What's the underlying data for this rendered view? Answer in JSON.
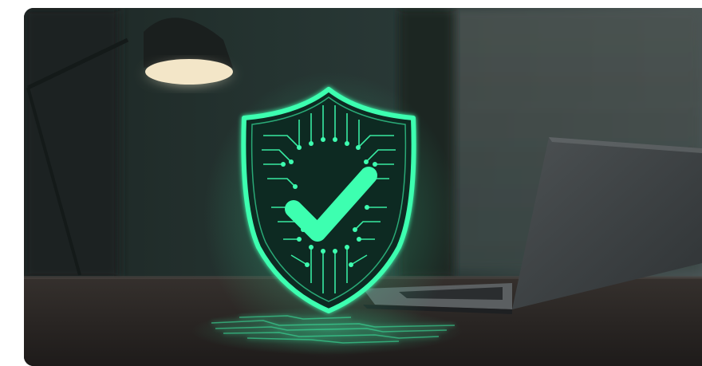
{
  "image": {
    "subject": "hero-photo",
    "colors": {
      "glow": "#3dffb0",
      "shield_fill": "#0d2a21",
      "desk": "#2a2624",
      "laptop": "#3d4143",
      "background_dark": "#1a2624",
      "lamp_light": "#f3e6c8"
    }
  }
}
